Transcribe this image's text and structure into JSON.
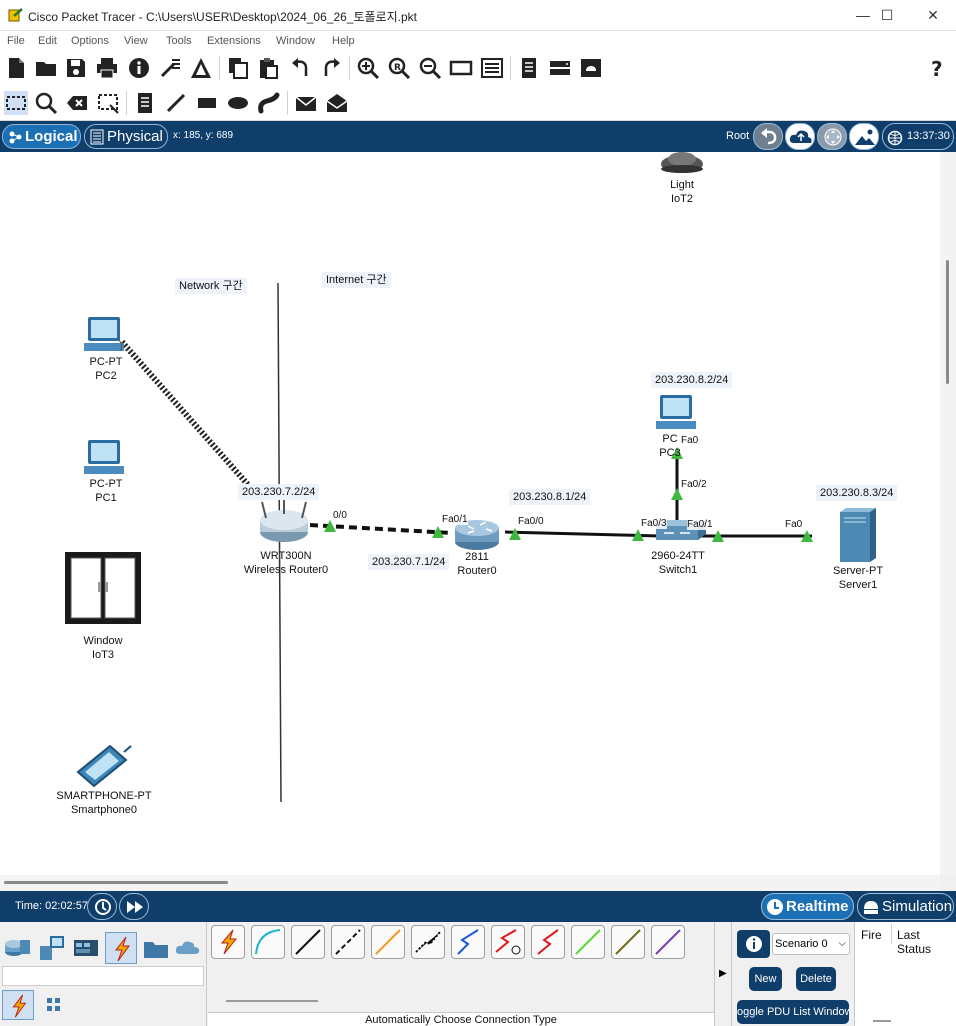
{
  "window": {
    "title": "Cisco Packet Tracer - C:\\Users\\USER\\Desktop\\2024_06_26_토폴로지.pkt",
    "minimize": "—",
    "maximize": "☐",
    "close": "✕"
  },
  "menu": [
    "File",
    "Edit",
    "Options",
    "View",
    "Tools",
    "Extensions",
    "Window",
    "Help"
  ],
  "toolbar": {
    "main_icons": [
      "new-file-icon",
      "open-folder-icon",
      "save-icon",
      "print-icon",
      "info-icon",
      "activity-wizard-icon",
      "custom-device-icon",
      "copy-icon",
      "paste-icon",
      "undo-icon",
      "redo-icon",
      "zoom-in-icon",
      "zoom-reset-icon",
      "zoom-out-icon",
      "drawing-palette-icon",
      "custom-devices-dialog-icon",
      "note-icon",
      "device-icon",
      "cluster-icon",
      "help-icon"
    ],
    "edit_icons": [
      "select-icon",
      "inspect-icon",
      "delete-icon",
      "resize-icon",
      "note-icon",
      "line-icon",
      "rectangle-icon",
      "ellipse-icon",
      "freeform-icon",
      "simple-pdu-icon",
      "complex-pdu-icon"
    ]
  },
  "workspace_header": {
    "logical_tab": "Logical",
    "physical_tab": "Physical",
    "coordinates": "x: 185, y: 689",
    "root": "Root",
    "clock": "13:37:30"
  },
  "topology": {
    "devices": [
      {
        "id": "light-iot2",
        "type": "Light",
        "name": "IoT2"
      },
      {
        "id": "pc2",
        "type": "PC-PT",
        "name": "PC2"
      },
      {
        "id": "pc1",
        "type": "PC-PT",
        "name": "PC1"
      },
      {
        "id": "window-iot3",
        "type": "Window",
        "name": "IoT3"
      },
      {
        "id": "smartphone0",
        "type": "SMARTPHONE-PT",
        "name": "Smartphone0"
      },
      {
        "id": "wireless-router0",
        "type": "WRT300N",
        "name": "Wireless Router0"
      },
      {
        "id": "router0",
        "type": "2811",
        "name": "Router0"
      },
      {
        "id": "switch1",
        "type": "2960-24TT",
        "name": "Switch1"
      },
      {
        "id": "server1",
        "type": "Server-PT",
        "name": "Server1"
      },
      {
        "id": "pc3",
        "type": "PC",
        "name": "PC3"
      }
    ],
    "notes": {
      "network_zone": "Network 구간",
      "internet_zone": "Internet 구간",
      "pc3_ip": "203.230.8.2/24",
      "wrt_ip": "203.230.7.2/24",
      "router_fa00_ip": "203.230.8.1/24",
      "router_fa01_ip": "203.230.7.1/24",
      "server_ip": "203.230.8.3/24"
    },
    "ports": {
      "wrt_internet": "0/0",
      "router_fa01": "Fa0/1",
      "router_fa00": "Fa0/0",
      "switch_fa03": "Fa0/3",
      "switch_fa01": "Fa0/1",
      "switch_fa02": "Fa0/2",
      "pc3_fa0": "Fa0",
      "server_fa0": "Fa0"
    }
  },
  "timebar": {
    "time": "Time: 02:02:57",
    "realtime": "Realtime",
    "simulation": "Simulation"
  },
  "bottom": {
    "connection_caption": "Automatically Choose Connection Type",
    "scenario": "Scenario 0",
    "new_button": "New",
    "delete_button": "Delete",
    "toggle_pdu": "oggle PDU List Window",
    "pdu_columns": [
      "Fire",
      "Last Status"
    ],
    "cable_colors": [
      "#e8a000",
      "#1bb6c8",
      "#111111",
      "#111111",
      "#f39a1e",
      "#111111",
      "#1a5ad8",
      "#e01a1a",
      "#e01a1a",
      "#5bd83a",
      "#6b6b1a",
      "#7a3fb0"
    ]
  },
  "colors": {
    "header_blue": "#0f3e6b",
    "active_tab": "#1a6fb5",
    "link_up": "#3fb83f"
  }
}
